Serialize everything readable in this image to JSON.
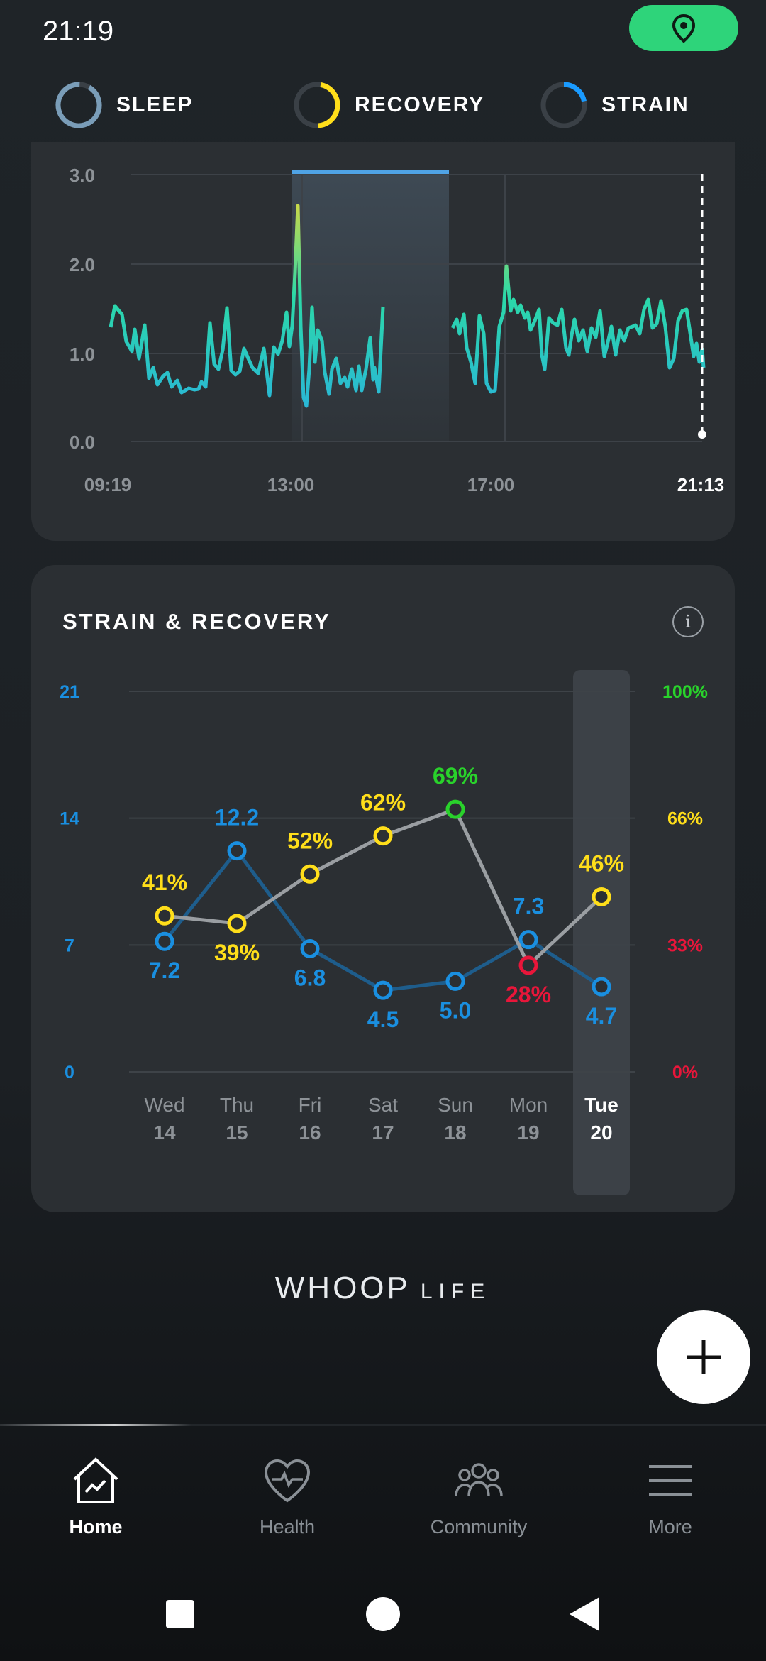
{
  "status_bar": {
    "time": "21:19",
    "location_icon": "location-pin-icon",
    "pill_color": "#2ed47a"
  },
  "tabs": [
    {
      "label": "SLEEP",
      "ring_color": "#7a9db8",
      "fill": 0.92
    },
    {
      "label": "RECOVERY",
      "ring_color": "#ffde1a",
      "fill": 0.46
    },
    {
      "label": "STRAIN",
      "ring_color": "#1a9bff",
      "fill": 0.22
    }
  ],
  "hr_chart": {
    "y_ticks": [
      "3.0",
      "2.0",
      "1.0",
      "0.0"
    ],
    "x_ticks": [
      "09:19",
      "13:00",
      "17:00",
      "21:13"
    ],
    "line_color": "#2bd9a8",
    "peak_color": "#c7d94a"
  },
  "strain_recovery": {
    "title": "STRAIN & RECOVERY",
    "info_label": "i",
    "left_axis": [
      "21",
      "14",
      "7",
      "0"
    ],
    "right_axis": [
      "100%",
      "66%",
      "33%",
      "0%"
    ],
    "days": [
      {
        "day": "Wed",
        "date": "14"
      },
      {
        "day": "Thu",
        "date": "15"
      },
      {
        "day": "Fri",
        "date": "16"
      },
      {
        "day": "Sat",
        "date": "17"
      },
      {
        "day": "Sun",
        "date": "18"
      },
      {
        "day": "Mon",
        "date": "19"
      },
      {
        "day": "Tue",
        "date": "20"
      }
    ],
    "colors": {
      "strain": "#1a8fe0",
      "recovery_yellow": "#ffde1a",
      "recovery_green": "#29d22b",
      "recovery_red": "#e8163a",
      "recovery_line": "#9a9ea2"
    }
  },
  "chart_data": {
    "type": "line",
    "title": "STRAIN & RECOVERY",
    "categories": [
      "Wed 14",
      "Thu 15",
      "Fri 16",
      "Sat 17",
      "Sun 18",
      "Mon 19",
      "Tue 20"
    ],
    "strain_axis": [
      0,
      21
    ],
    "recovery_axis": [
      0,
      100
    ],
    "series": [
      {
        "values": [
          7.2,
          12.2,
          6.8,
          4.5,
          5.0,
          7.3,
          4.7
        ],
        "labels": [
          "7.2",
          "12.2",
          "6.8",
          "4.5",
          "5.0",
          "7.3",
          "4.7"
        ]
      },
      {
        "values": [
          41,
          39,
          52,
          62,
          69,
          28,
          46
        ],
        "labels": [
          "41%",
          "39%",
          "52%",
          "62%",
          "69%",
          "28%",
          "46%"
        ]
      }
    ],
    "selected_category": "Tue 20"
  },
  "brand": {
    "wordmark": "WHOOP",
    "suffix": "LIFE"
  },
  "fab": {
    "icon": "plus-icon"
  },
  "bottom_nav": [
    {
      "label": "Home",
      "icon": "home-icon",
      "active": true
    },
    {
      "label": "Health",
      "icon": "heart-pulse-icon",
      "active": false
    },
    {
      "label": "Community",
      "icon": "people-icon",
      "active": false
    },
    {
      "label": "More",
      "icon": "menu-icon",
      "active": false
    }
  ],
  "system_nav": {
    "recents": "square-icon",
    "home": "circle-icon",
    "back": "triangle-back-icon"
  }
}
